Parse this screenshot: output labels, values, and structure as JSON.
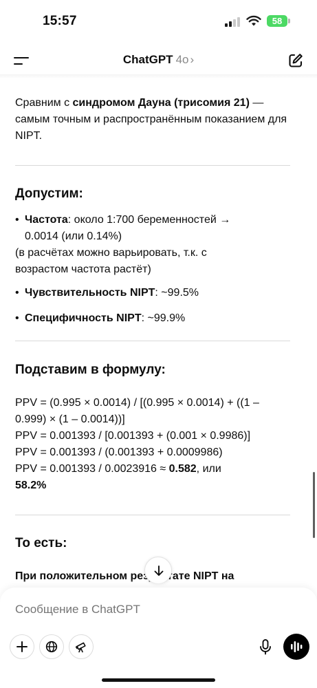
{
  "status_bar": {
    "time": "15:57",
    "battery": "58",
    "battery_color": "#4cd964"
  },
  "header": {
    "title": "ChatGPT",
    "model": "4o",
    "chevron": "›",
    "menu_icon": "menu-icon",
    "compose_icon": "compose-icon"
  },
  "message": {
    "intro_text": "Сравним с ",
    "intro_bold": "синдромом Дауна (трисомия 21)",
    "intro_rest": " — самым точным и распространённым показанием для NIPT.",
    "assume_heading": "Допустим:",
    "bullets": [
      {
        "bold": "Частота",
        "text": ": около 1:700 беременностей →",
        "cont": "0.0014 (или 0.14%)"
      },
      {
        "bold": "Чувствительность NIPT",
        "text": ": ~99.5%"
      },
      {
        "bold": "Специфичность NIPT",
        "text": ": ~99.9%"
      }
    ],
    "note": "(в расчётах можно варьировать, т.к. с возрастом частота растёт)",
    "formula_heading": "Подставим в формулу:",
    "formula_lines": [
      "PPV = (0.995 × 0.0014) / [(0.995 × 0.0014) + ((1 – 0.999) × (1 – 0.0014))]",
      "PPV = 0.001393 / [0.001393 + (0.001 × 0.9986)]",
      "PPV = 0.001393 / (0.001393 + 0.0009986)"
    ],
    "result_prefix": "PPV = 0.001393 / 0.0023916 ≈ ",
    "result_bold": "0.582",
    "result_mid": ", или ",
    "result_bold2": "58.2%",
    "thus_heading": "То есть:",
    "cut_text": "При положительном результате NIPT на"
  },
  "composer": {
    "placeholder": "Сообщение в ChatGPT",
    "buttons": [
      "plus-icon",
      "globe-icon",
      "telescope-icon",
      "mic-icon",
      "voice-icon"
    ]
  }
}
